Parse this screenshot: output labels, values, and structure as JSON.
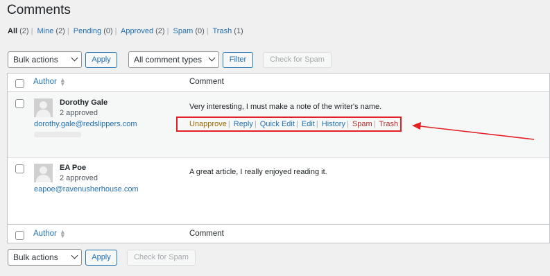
{
  "page": {
    "title": "Comments"
  },
  "filters": [
    {
      "label": "All",
      "count": "(2)",
      "current": true
    },
    {
      "label": "Mine",
      "count": "(2)"
    },
    {
      "label": "Pending",
      "count": "(0)"
    },
    {
      "label": "Approved",
      "count": "(2)"
    },
    {
      "label": "Spam",
      "count": "(0)"
    },
    {
      "label": "Trash",
      "count": "(1)"
    }
  ],
  "toolbar": {
    "bulk_actions": "Bulk actions",
    "apply": "Apply",
    "comment_types": "All comment types",
    "filter": "Filter",
    "check_spam": "Check for Spam"
  },
  "table": {
    "col_author": "Author",
    "col_comment": "Comment",
    "rows": [
      {
        "name": "Dorothy Gale",
        "approved": "2 approved",
        "email": "dorothy.gale@redslippers.com",
        "comment": "Very interesting, I must make a note of the writer's name.",
        "actions": [
          "Unapprove",
          "Reply",
          "Quick Edit",
          "Edit",
          "History",
          "Spam",
          "Trash"
        ]
      },
      {
        "name": "EA Poe",
        "approved": "2 approved",
        "email": "eapoe@ravenusherhouse.com",
        "comment": "A great article, I really enjoyed reading it."
      }
    ]
  },
  "bottom_toolbar": {
    "bulk_actions": "Bulk actions",
    "apply": "Apply",
    "check_spam": "Check for Spam"
  },
  "colors": {
    "link": "#2271b1",
    "highlight": "#e31e24",
    "unapprove": "#996800",
    "danger": "#b32d2e"
  }
}
